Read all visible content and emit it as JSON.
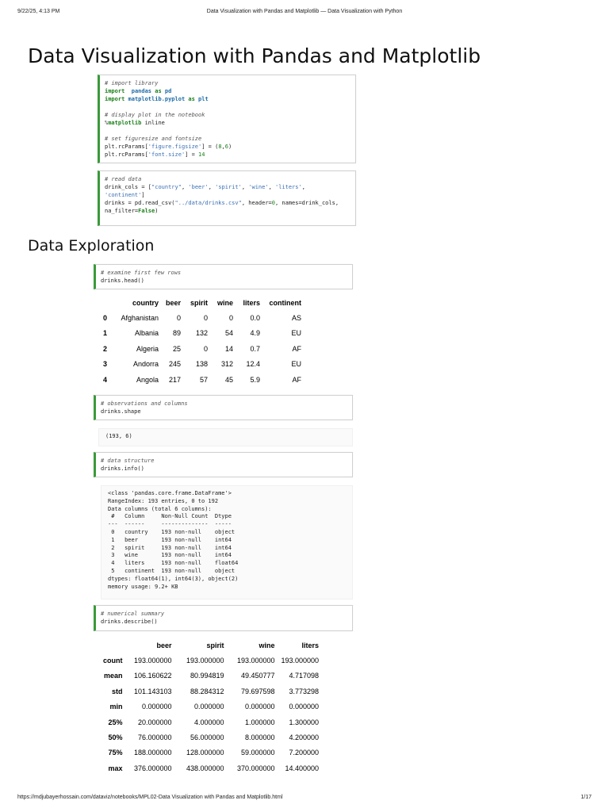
{
  "header": {
    "datetime": "9/22/25, 4:13 PM",
    "page_title": "Data Visualization with Pandas and Matplotlib — Data Visualization with Python"
  },
  "title": "Data Visualization with Pandas and Matplotlib",
  "section_title": "Data Exploration",
  "cells": {
    "imports": [
      [
        [
          "cm",
          "# import library"
        ]
      ],
      [
        [
          "kw",
          "import"
        ],
        [
          "",
          "  "
        ],
        [
          "nm",
          "pandas"
        ],
        [
          "",
          ""
        ],
        [
          "kw",
          " as "
        ],
        [
          "nm",
          "pd"
        ]
      ],
      [
        [
          "kw",
          "import"
        ],
        [
          "",
          " "
        ],
        [
          "nm",
          "matplotlib.pyplot"
        ],
        [
          "kw",
          " as "
        ],
        [
          "nm",
          "plt"
        ]
      ],
      [],
      [
        [
          "cm",
          "# display plot in the notebook"
        ]
      ],
      [
        [
          "mg",
          "%"
        ],
        [
          "kw",
          "matplotlib"
        ],
        [
          "",
          " inline"
        ]
      ],
      [],
      [
        [
          "cm",
          "# set figuresize and fontsize"
        ]
      ],
      [
        [
          "",
          "plt.rcParams["
        ],
        [
          "st",
          "'figure.figsize'"
        ],
        [
          "",
          "] = ("
        ],
        [
          "num",
          "8"
        ],
        [
          "",
          ","
        ],
        [
          "num",
          "6"
        ],
        [
          "",
          ")"
        ]
      ],
      [
        [
          "",
          "plt.rcParams["
        ],
        [
          "st",
          "'font.size'"
        ],
        [
          "",
          "] = "
        ],
        [
          "num",
          "14"
        ]
      ]
    ],
    "read_data": [
      [
        [
          "cm",
          "# read data"
        ]
      ],
      [
        [
          "",
          "drink_cols = ["
        ],
        [
          "st",
          "\"country\""
        ],
        [
          "",
          ", "
        ],
        [
          "st",
          "'beer'"
        ],
        [
          "",
          ", "
        ],
        [
          "st",
          "'spirit'"
        ],
        [
          "",
          ", "
        ],
        [
          "st",
          "'wine'"
        ],
        [
          "",
          ", "
        ],
        [
          "st",
          "'liters'"
        ],
        [
          "",
          ","
        ]
      ],
      [
        [
          "st",
          "'continent'"
        ],
        [
          "",
          "]"
        ]
      ],
      [
        [
          "",
          "drinks = pd.read_csv("
        ],
        [
          "st",
          "\"../data/drinks.csv\""
        ],
        [
          "",
          ", header="
        ],
        [
          "num",
          "0"
        ],
        [
          "",
          ", names=drink_cols,"
        ]
      ],
      [
        [
          "",
          "na_filter="
        ],
        [
          "kw",
          "False"
        ],
        [
          "",
          ")"
        ]
      ]
    ],
    "head": [
      [
        [
          "cm",
          "# examine first few rows"
        ]
      ],
      [
        [
          "",
          "drinks.head()"
        ]
      ]
    ],
    "shape": [
      [
        [
          "cm",
          "# observations and columns"
        ]
      ],
      [
        [
          "",
          "drinks.shape"
        ]
      ]
    ],
    "info": [
      [
        [
          "cm",
          "# data structure"
        ]
      ],
      [
        [
          "",
          "drinks.info()"
        ]
      ]
    ],
    "describe": [
      [
        [
          "cm",
          "# numerical summary"
        ]
      ],
      [
        [
          "",
          "drinks.describe()"
        ]
      ]
    ]
  },
  "head_table": {
    "columns": [
      "",
      "country",
      "beer",
      "spirit",
      "wine",
      "liters",
      "continent"
    ],
    "rows": [
      [
        "0",
        "Afghanistan",
        "0",
        "0",
        "0",
        "0.0",
        "AS"
      ],
      [
        "1",
        "Albania",
        "89",
        "132",
        "54",
        "4.9",
        "EU"
      ],
      [
        "2",
        "Algeria",
        "25",
        "0",
        "14",
        "0.7",
        "AF"
      ],
      [
        "3",
        "Andorra",
        "245",
        "138",
        "312",
        "12.4",
        "EU"
      ],
      [
        "4",
        "Angola",
        "217",
        "57",
        "45",
        "5.9",
        "AF"
      ]
    ]
  },
  "shape_output": "(193, 6)",
  "info_output": [
    "<class 'pandas.core.frame.DataFrame'>",
    "RangeIndex: 193 entries, 0 to 192",
    "Data columns (total 6 columns):",
    " #   Column     Non-Null Count  Dtype  ",
    "---  ------     --------------  -----  ",
    " 0   country    193 non-null    object ",
    " 1   beer       193 non-null    int64  ",
    " 2   spirit     193 non-null    int64  ",
    " 3   wine       193 non-null    int64  ",
    " 4   liters     193 non-null    float64",
    " 5   continent  193 non-null    object ",
    "dtypes: float64(1), int64(3), object(2)",
    "memory usage: 9.2+ KB"
  ],
  "describe_table": {
    "columns": [
      "",
      "beer",
      "spirit",
      "wine",
      "liters"
    ],
    "rows": [
      [
        "count",
        "193.000000",
        "193.000000",
        "193.000000",
        "193.000000"
      ],
      [
        "mean",
        "106.160622",
        "80.994819",
        "49.450777",
        "4.717098"
      ],
      [
        "std",
        "101.143103",
        "88.284312",
        "79.697598",
        "3.773298"
      ],
      [
        "min",
        "0.000000",
        "0.000000",
        "0.000000",
        "0.000000"
      ],
      [
        "25%",
        "20.000000",
        "4.000000",
        "1.000000",
        "1.300000"
      ],
      [
        "50%",
        "76.000000",
        "56.000000",
        "8.000000",
        "4.200000"
      ],
      [
        "75%",
        "188.000000",
        "128.000000",
        "59.000000",
        "7.200000"
      ],
      [
        "max",
        "376.000000",
        "438.000000",
        "370.000000",
        "14.400000"
      ]
    ]
  },
  "footer": {
    "url": "https://mdjubayerhossain.com/dataviz/notebooks/MPL02-Data Visualization with Pandas and Matplotlib.html",
    "page": "1/17"
  }
}
